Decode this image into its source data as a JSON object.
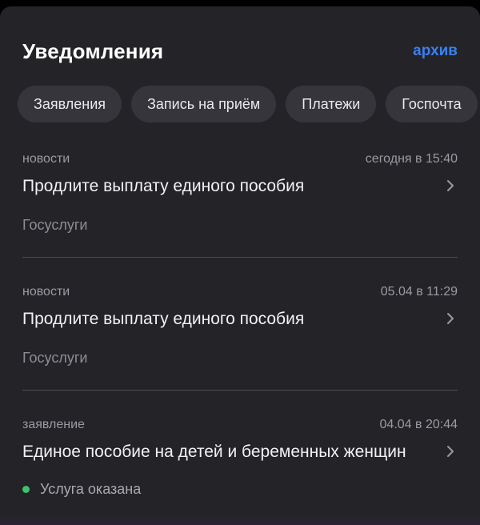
{
  "header": {
    "title": "Уведомления",
    "archive_label": "архив"
  },
  "filters": [
    "Заявления",
    "Запись на приём",
    "Платежи",
    "Госпочта"
  ],
  "notifications": [
    {
      "category": "новости",
      "time": "сегодня в 15:40",
      "title": "Продлите выплату единого пособия",
      "source": "Госуслуги"
    },
    {
      "category": "новости",
      "time": "05.04 в 11:29",
      "title": "Продлите выплату единого пособия",
      "source": "Госуслуги"
    },
    {
      "category": "заявление",
      "time": "04.04 в 20:44",
      "title": "Единое пособие на детей и беременных женщин",
      "status": "Услуга оказана",
      "status_color": "#3fc46b"
    }
  ],
  "colors": {
    "accent": "#3d7ff0",
    "background": "#242428",
    "chip": "#35353b"
  }
}
